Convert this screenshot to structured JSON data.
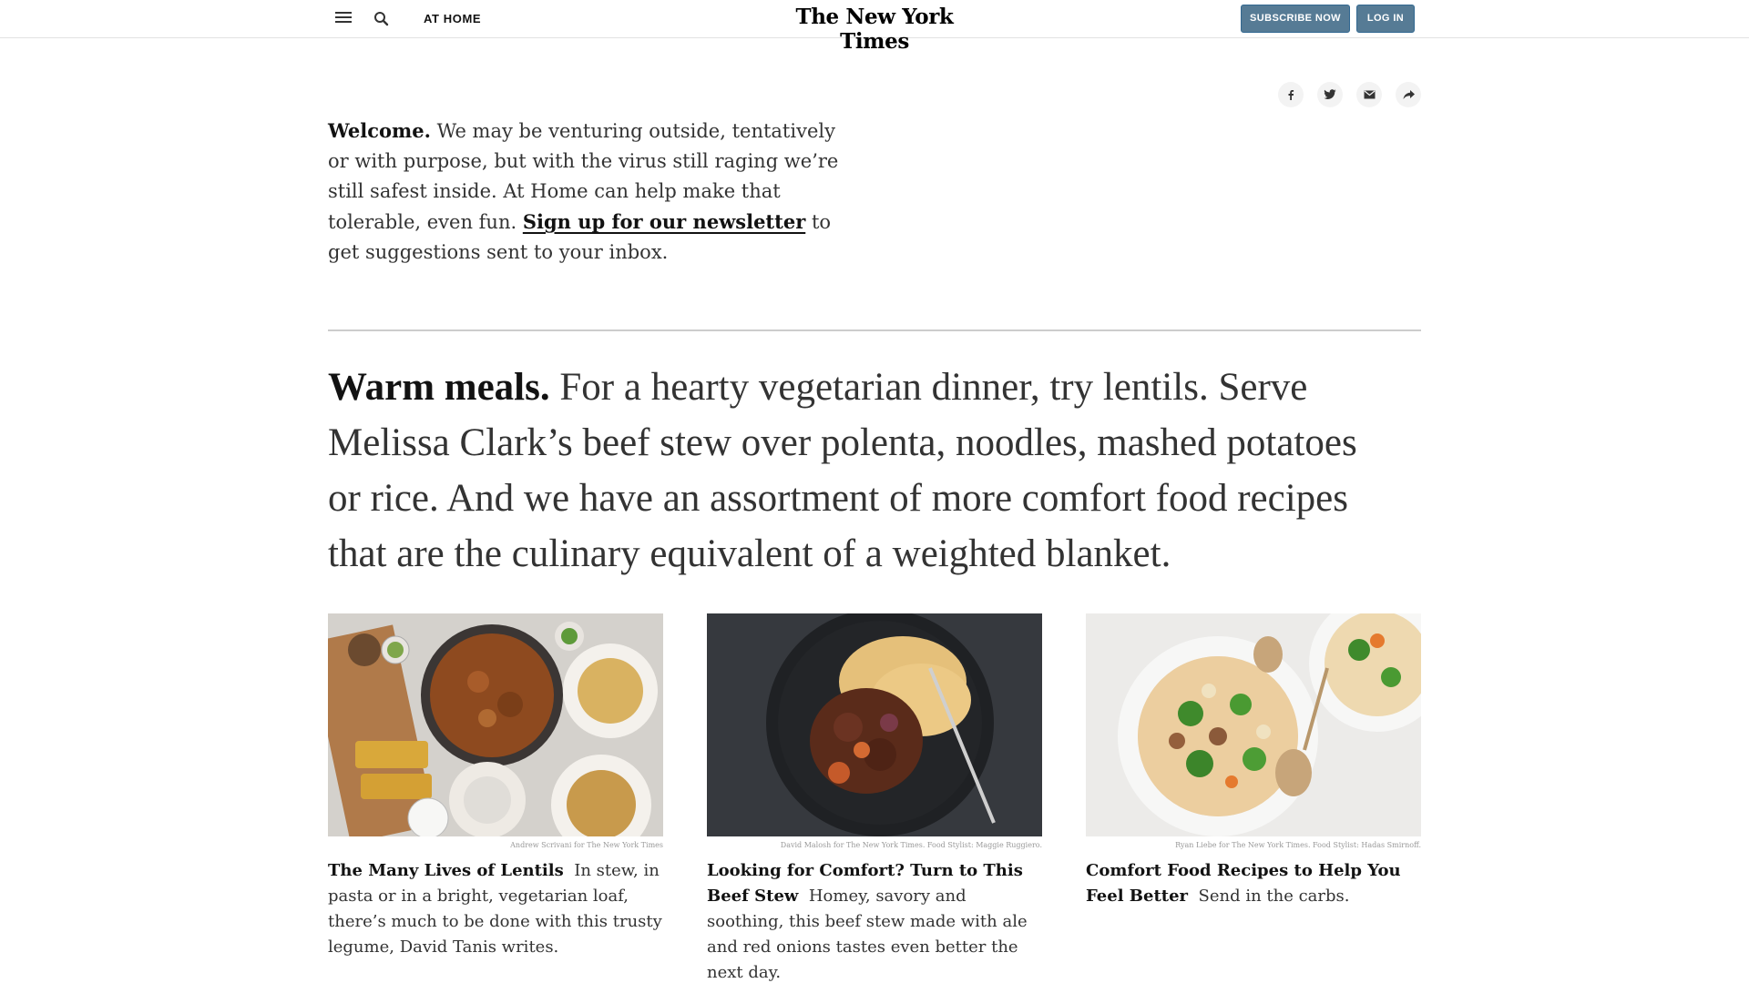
{
  "header": {
    "section": "AT HOME",
    "masthead": "The New York Times",
    "subscribe_label": "SUBSCRIBE NOW",
    "login_label": "LOG IN"
  },
  "share_icons": [
    "facebook-icon",
    "twitter-icon",
    "email-icon",
    "share-arrow-icon"
  ],
  "welcome": {
    "lead": "Welcome.",
    "body": " We may be venturing outside, tentatively or with purpose, but with the virus still raging we’re still safest inside. At Home can help make that tolerable, even fun. ",
    "link": "Sign up for our newsletter",
    "tail": " to get suggestions sent to your inbox."
  },
  "warm": {
    "lead": "Warm meals.",
    "body": " For a hearty vegetarian dinner, try lentils. Serve Melissa Clark’s beef stew over polenta, noodles, mashed potatoes or rice. And we have an assortment of more comfort food recipes that are the culinary equivalent of a weighted blanket."
  },
  "cards": [
    {
      "credit": "Andrew Scrivani for The New York Times",
      "title": "The Many Lives of Lentils",
      "summary": "In stew, in pasta or in a bright, vegetarian loaf, there’s much to be done with this trusty legume, David Tanis writes."
    },
    {
      "credit": "David Malosh for The New York Times. Food Stylist: Maggie Ruggiero.",
      "title": "Looking for Comfort? Turn to This Beef Stew",
      "summary": "Homey, savory and soothing, this beef stew made with ale and red onions tastes even better the next day."
    },
    {
      "credit": "Ryan Liebe for The New York Times. Food Stylist: Hadas Smirnoff.",
      "title": "Comfort Food Recipes to Help You Feel Better",
      "summary": "Send in the carbs."
    }
  ],
  "colors": {
    "button_bg": "#567b95",
    "text": "#121212",
    "body_text": "#333333"
  }
}
